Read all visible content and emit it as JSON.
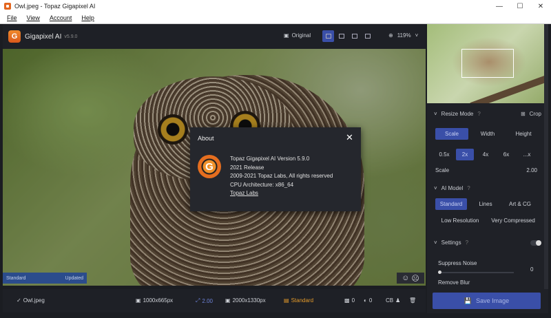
{
  "window": {
    "title": "Owl.jpeg - Topaz Gigapixel AI"
  },
  "menu": [
    "File",
    "View",
    "Account",
    "Help"
  ],
  "toolbar": {
    "app_name": "Gigapixel AI",
    "version": "v5.9.0",
    "original_label": "Original",
    "zoom": "119%"
  },
  "canvas": {
    "left_label": "Standard",
    "right_label": "Updated"
  },
  "about": {
    "title": "About",
    "lines": [
      "Topaz Gigapixel AI Version 5.9.0",
      "2021 Release",
      "2009-2021 Topaz Labs, All rights reserved",
      "CPU Architecture: x86_64"
    ],
    "link": "Topaz Labs"
  },
  "bottom": {
    "filename": "Owl.jpeg",
    "input_size": "1000x665px",
    "scale": "2.00",
    "output_size": "2000x1330px",
    "model": "Standard",
    "count_a": "0",
    "count_b": "0",
    "cb": "CB"
  },
  "panel": {
    "resize_mode": "Resize Mode",
    "crop": "Crop",
    "resize_tabs": [
      "Scale",
      "Width",
      "Height"
    ],
    "scales": [
      "0.5x",
      "2x",
      "4x",
      "6x",
      "...x"
    ],
    "scale_label": "Scale",
    "scale_value": "2.00",
    "ai_model": "AI Model",
    "models_row1": [
      "Standard",
      "Lines",
      "Art & CG"
    ],
    "models_row2": [
      "Low Resolution",
      "Very Compressed"
    ],
    "settings": "Settings",
    "suppress_noise": "Suppress Noise",
    "suppress_value": "0",
    "remove_blur": "Remove Blur",
    "save_button": "Save Image"
  }
}
